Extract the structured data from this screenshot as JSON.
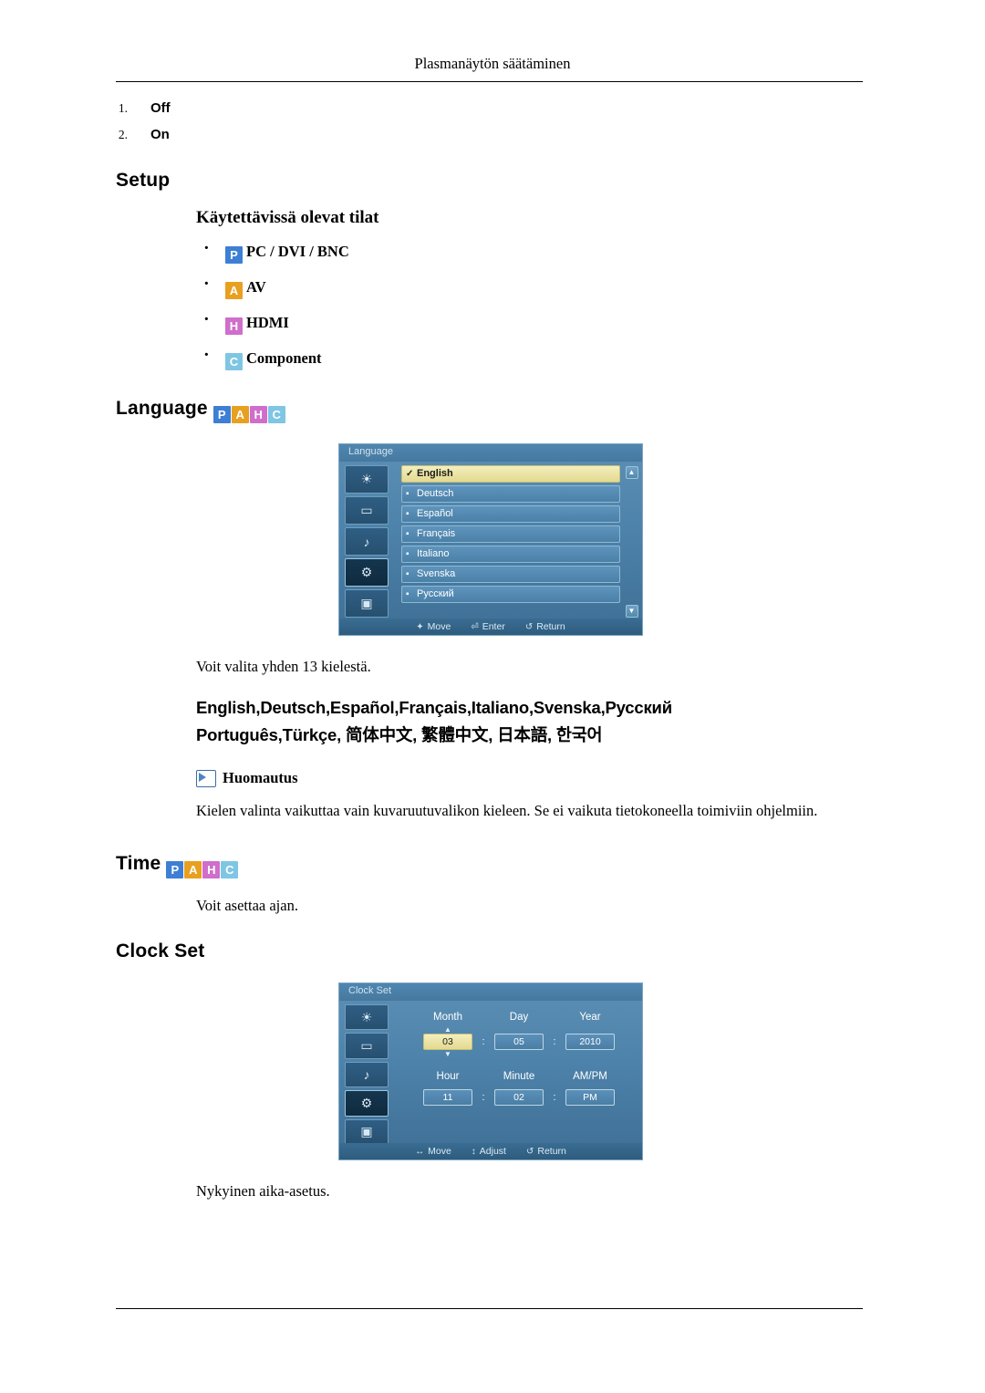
{
  "header": {
    "title": "Plasmanäytön säätäminen"
  },
  "numlist": [
    {
      "num": "1.",
      "label": "Off"
    },
    {
      "num": "2.",
      "label": "On"
    }
  ],
  "setup": {
    "heading": "Setup",
    "subheading": "Käytettävissä olevat tilat",
    "modes": [
      {
        "badge": "P",
        "badge_class": "p",
        "label": "PC / DVI / BNC"
      },
      {
        "badge": "A",
        "badge_class": "a",
        "label": "AV"
      },
      {
        "badge": "H",
        "badge_class": "h",
        "label": "HDMI"
      },
      {
        "badge": "C",
        "badge_class": "c",
        "label": "Component"
      }
    ]
  },
  "language": {
    "heading": "Language",
    "badges": [
      "P",
      "A",
      "H",
      "C"
    ],
    "caption": "Voit valita yhden 13 kielestä.",
    "list_line1": "English,Deutsch,Español,Français,Italiano,Svenska,Русский",
    "list_line2": "Português,Türkçe, 简体中文,  繁體中文, 日本語, 한국어",
    "note_title": "Huomautus",
    "note_body": "Kielen valinta vaikuttaa vain kuvaruutuvalikon kieleen. Se ei vaikuta tietokoneella toimiviin ohjelmiin.",
    "osd": {
      "title": "Language",
      "rows": [
        {
          "label": "English",
          "selected": true
        },
        {
          "label": "Deutsch",
          "selected": false
        },
        {
          "label": "Español",
          "selected": false
        },
        {
          "label": "Français",
          "selected": false
        },
        {
          "label": "Italiano",
          "selected": false
        },
        {
          "label": "Svenska",
          "selected": false
        },
        {
          "label": "Русский",
          "selected": false
        }
      ],
      "scroll_up": "▲",
      "scroll_down": "▼",
      "footer": [
        {
          "glyph": "✦",
          "label": "Move"
        },
        {
          "glyph": "⏎",
          "label": "Enter"
        },
        {
          "glyph": "↺",
          "label": "Return"
        }
      ]
    }
  },
  "time": {
    "heading": "Time",
    "badges": [
      "P",
      "A",
      "H",
      "C"
    ],
    "caption": "Voit asettaa ajan."
  },
  "clock": {
    "heading": "Clock Set",
    "caption": "Nykyinen aika-asetus.",
    "osd": {
      "title": "Clock Set",
      "labels_row1": [
        "Month",
        "Day",
        "Year"
      ],
      "values_row1": [
        "03",
        "05",
        "2010"
      ],
      "labels_row2": [
        "Hour",
        "Minute",
        "AM/PM"
      ],
      "values_row2": [
        "11",
        "02",
        "PM"
      ],
      "separator": ":",
      "spin_up": "▲",
      "spin_down": "▼",
      "footer": [
        {
          "glyph": "↔",
          "label": "Move"
        },
        {
          "glyph": "↕",
          "label": "Adjust"
        },
        {
          "glyph": "↺",
          "label": "Return"
        }
      ]
    }
  }
}
